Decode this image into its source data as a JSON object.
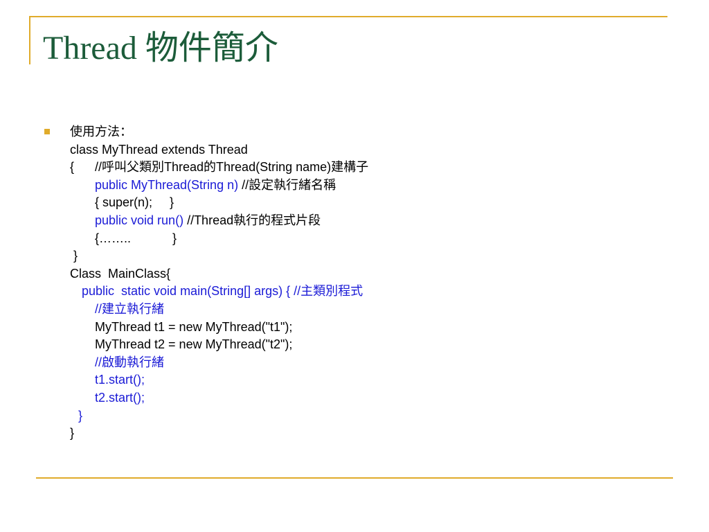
{
  "slide": {
    "title": "Thread 物件簡介",
    "lines": [
      [
        {
          "t": "使用方法：",
          "c": "black"
        }
      ],
      [
        {
          "t": "class MyThread extends Thread",
          "c": "black"
        }
      ],
      [
        {
          "t": "{      //呼叫父類別Thread的Thread(String name)建構子",
          "c": "black"
        }
      ],
      [
        {
          "t": "public MyThread(String n) ",
          "c": "blue"
        },
        {
          "t": "//設定執行緒名稱",
          "c": "black"
        }
      ],
      [
        {
          "t": "{ super(n);     }",
          "c": "black"
        }
      ],
      [
        {
          "t": "public void run() ",
          "c": "blue"
        },
        {
          "t": "//Thread執行的程式片段",
          "c": "black"
        }
      ],
      [
        {
          "t": "{……..            }",
          "c": "black"
        }
      ],
      [
        {
          "t": " }",
          "c": "black"
        }
      ],
      [
        {
          "t": "Class  MainClass{",
          "c": "black"
        }
      ],
      [
        {
          "t": "public  static void main(String[] args) { //主類別程式",
          "c": "blue"
        }
      ],
      [
        {
          "t": "//建立執行緒",
          "c": "blue"
        }
      ],
      [
        {
          "t": "MyThread t1 = new MyThread(\"t1\");",
          "c": "black"
        }
      ],
      [
        {
          "t": "MyThread t2 = new MyThread(\"t2\");",
          "c": "black"
        }
      ],
      [
        {
          "t": "//啟動執行緒",
          "c": "blue"
        }
      ],
      [
        {
          "t": "t1.start();",
          "c": "blue"
        }
      ],
      [
        {
          "t": "t2.start();",
          "c": "blue"
        }
      ],
      [
        {
          "t": "}",
          "c": "blue"
        }
      ],
      [
        {
          "t": "}",
          "c": "black"
        }
      ]
    ]
  },
  "colors": {
    "accent": "#e0ab2b",
    "title": "#1c5c3a",
    "code_blue": "#1a1ad6"
  }
}
